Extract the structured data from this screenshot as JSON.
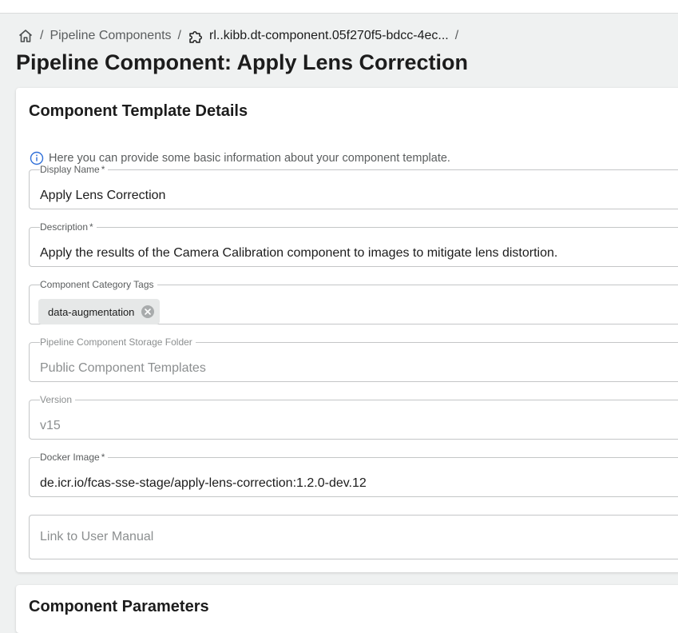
{
  "breadcrumb": {
    "home_icon": "home-icon",
    "separator": "/",
    "items": [
      {
        "label": "Pipeline Components"
      },
      {
        "label": "rl..kibb.dt-component.05f270f5-bdcc-4ec...",
        "icon": "puzzle-icon"
      }
    ]
  },
  "page": {
    "title": "Pipeline Component: Apply Lens Correction"
  },
  "details": {
    "title": "Component Template Details",
    "info_text": "Here you can provide some basic information about your component template.",
    "required_marker": "*",
    "fields": {
      "display_name": {
        "label": "Display Name",
        "value": "Apply Lens Correction"
      },
      "description": {
        "label": "Description",
        "value": "Apply the results of the Camera Calibration component to images to mitigate lens distortion."
      },
      "tags": {
        "label": "Component Category Tags",
        "chips": [
          "data-augmentation"
        ]
      },
      "storage_folder": {
        "label": "Pipeline Component Storage Folder",
        "value": "Public Component Templates"
      },
      "version": {
        "label": "Version",
        "value": "v15"
      },
      "docker_image": {
        "label": "Docker Image",
        "value": "de.icr.io/fcas-sse-stage/apply-lens-correction:1.2.0-dev.12"
      },
      "user_manual": {
        "placeholder": "Link to User Manual"
      }
    }
  },
  "parameters": {
    "title": "Component Parameters"
  },
  "colors": {
    "background": "#eff1f1",
    "info_icon": "#2f6fd8",
    "border": "#c4c6c7",
    "chip_bg": "#e6e8e8"
  }
}
